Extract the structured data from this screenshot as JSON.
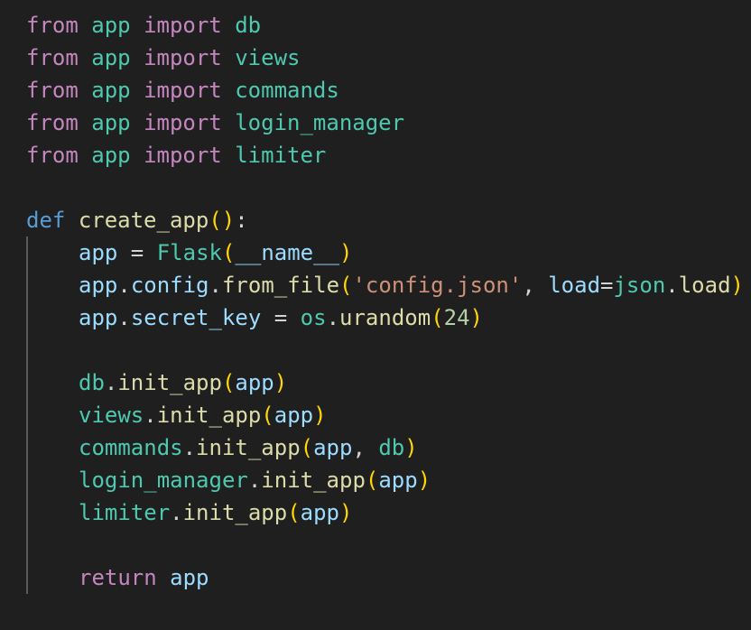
{
  "code": {
    "lines": [
      {
        "tokens": [
          {
            "t": "from",
            "c": "kw"
          },
          {
            "t": " ",
            "c": "punc"
          },
          {
            "t": "app",
            "c": "mod"
          },
          {
            "t": " ",
            "c": "punc"
          },
          {
            "t": "import",
            "c": "kw"
          },
          {
            "t": " ",
            "c": "punc"
          },
          {
            "t": "db",
            "c": "mod"
          }
        ]
      },
      {
        "tokens": [
          {
            "t": "from",
            "c": "kw"
          },
          {
            "t": " ",
            "c": "punc"
          },
          {
            "t": "app",
            "c": "mod"
          },
          {
            "t": " ",
            "c": "punc"
          },
          {
            "t": "import",
            "c": "kw"
          },
          {
            "t": " ",
            "c": "punc"
          },
          {
            "t": "views",
            "c": "mod"
          }
        ]
      },
      {
        "tokens": [
          {
            "t": "from",
            "c": "kw"
          },
          {
            "t": " ",
            "c": "punc"
          },
          {
            "t": "app",
            "c": "mod"
          },
          {
            "t": " ",
            "c": "punc"
          },
          {
            "t": "import",
            "c": "kw"
          },
          {
            "t": " ",
            "c": "punc"
          },
          {
            "t": "commands",
            "c": "mod"
          }
        ]
      },
      {
        "tokens": [
          {
            "t": "from",
            "c": "kw"
          },
          {
            "t": " ",
            "c": "punc"
          },
          {
            "t": "app",
            "c": "mod"
          },
          {
            "t": " ",
            "c": "punc"
          },
          {
            "t": "import",
            "c": "kw"
          },
          {
            "t": " ",
            "c": "punc"
          },
          {
            "t": "login_manager",
            "c": "mod"
          }
        ]
      },
      {
        "tokens": [
          {
            "t": "from",
            "c": "kw"
          },
          {
            "t": " ",
            "c": "punc"
          },
          {
            "t": "app",
            "c": "mod"
          },
          {
            "t": " ",
            "c": "punc"
          },
          {
            "t": "import",
            "c": "kw"
          },
          {
            "t": " ",
            "c": "punc"
          },
          {
            "t": "limiter",
            "c": "mod"
          }
        ]
      },
      {
        "tokens": []
      },
      {
        "tokens": [
          {
            "t": "def",
            "c": "def"
          },
          {
            "t": " ",
            "c": "punc"
          },
          {
            "t": "create_app",
            "c": "fn"
          },
          {
            "t": "()",
            "c": "paren"
          },
          {
            "t": ":",
            "c": "punc"
          }
        ]
      },
      {
        "indent": true,
        "tokens": [
          {
            "t": "app",
            "c": "var"
          },
          {
            "t": " = ",
            "c": "punc"
          },
          {
            "t": "Flask",
            "c": "mod"
          },
          {
            "t": "(",
            "c": "paren"
          },
          {
            "t": "__name__",
            "c": "var"
          },
          {
            "t": ")",
            "c": "paren"
          }
        ]
      },
      {
        "indent": true,
        "tokens": [
          {
            "t": "app",
            "c": "var"
          },
          {
            "t": ".",
            "c": "punc"
          },
          {
            "t": "config",
            "c": "var"
          },
          {
            "t": ".",
            "c": "punc"
          },
          {
            "t": "from_file",
            "c": "fn"
          },
          {
            "t": "(",
            "c": "paren"
          },
          {
            "t": "'config.json'",
            "c": "str"
          },
          {
            "t": ", ",
            "c": "punc"
          },
          {
            "t": "load",
            "c": "var"
          },
          {
            "t": "=",
            "c": "punc"
          },
          {
            "t": "json",
            "c": "mod"
          },
          {
            "t": ".",
            "c": "punc"
          },
          {
            "t": "load",
            "c": "fn"
          },
          {
            "t": ")",
            "c": "paren"
          }
        ]
      },
      {
        "indent": true,
        "tokens": [
          {
            "t": "app",
            "c": "var"
          },
          {
            "t": ".",
            "c": "punc"
          },
          {
            "t": "secret_key",
            "c": "var"
          },
          {
            "t": " = ",
            "c": "punc"
          },
          {
            "t": "os",
            "c": "mod"
          },
          {
            "t": ".",
            "c": "punc"
          },
          {
            "t": "urandom",
            "c": "fn"
          },
          {
            "t": "(",
            "c": "paren"
          },
          {
            "t": "24",
            "c": "num"
          },
          {
            "t": ")",
            "c": "paren"
          }
        ]
      },
      {
        "indent": true,
        "tokens": []
      },
      {
        "indent": true,
        "tokens": [
          {
            "t": "db",
            "c": "mod"
          },
          {
            "t": ".",
            "c": "punc"
          },
          {
            "t": "init_app",
            "c": "fn"
          },
          {
            "t": "(",
            "c": "paren"
          },
          {
            "t": "app",
            "c": "var"
          },
          {
            "t": ")",
            "c": "paren"
          }
        ]
      },
      {
        "indent": true,
        "tokens": [
          {
            "t": "views",
            "c": "mod"
          },
          {
            "t": ".",
            "c": "punc"
          },
          {
            "t": "init_app",
            "c": "fn"
          },
          {
            "t": "(",
            "c": "paren"
          },
          {
            "t": "app",
            "c": "var"
          },
          {
            "t": ")",
            "c": "paren"
          }
        ]
      },
      {
        "indent": true,
        "tokens": [
          {
            "t": "commands",
            "c": "mod"
          },
          {
            "t": ".",
            "c": "punc"
          },
          {
            "t": "init_app",
            "c": "fn"
          },
          {
            "t": "(",
            "c": "paren"
          },
          {
            "t": "app",
            "c": "var"
          },
          {
            "t": ", ",
            "c": "punc"
          },
          {
            "t": "db",
            "c": "mod"
          },
          {
            "t": ")",
            "c": "paren"
          }
        ]
      },
      {
        "indent": true,
        "tokens": [
          {
            "t": "login_manager",
            "c": "mod"
          },
          {
            "t": ".",
            "c": "punc"
          },
          {
            "t": "init_app",
            "c": "fn"
          },
          {
            "t": "(",
            "c": "paren"
          },
          {
            "t": "app",
            "c": "var"
          },
          {
            "t": ")",
            "c": "paren"
          }
        ]
      },
      {
        "indent": true,
        "tokens": [
          {
            "t": "limiter",
            "c": "mod"
          },
          {
            "t": ".",
            "c": "punc"
          },
          {
            "t": "init_app",
            "c": "fn"
          },
          {
            "t": "(",
            "c": "paren"
          },
          {
            "t": "app",
            "c": "var"
          },
          {
            "t": ")",
            "c": "paren"
          }
        ]
      },
      {
        "indent": true,
        "tokens": []
      },
      {
        "indent": true,
        "tokens": [
          {
            "t": "return",
            "c": "kw"
          },
          {
            "t": " ",
            "c": "punc"
          },
          {
            "t": "app",
            "c": "var"
          }
        ]
      }
    ]
  },
  "theme": {
    "background": "#1f1f1f",
    "keyword": "#c586c0",
    "def_keyword": "#569cd6",
    "module": "#4ec9b0",
    "function": "#dcdcaa",
    "variable": "#9cdcfe",
    "string": "#ce9178",
    "number": "#b5cea8",
    "bracket": "#ffd700"
  }
}
